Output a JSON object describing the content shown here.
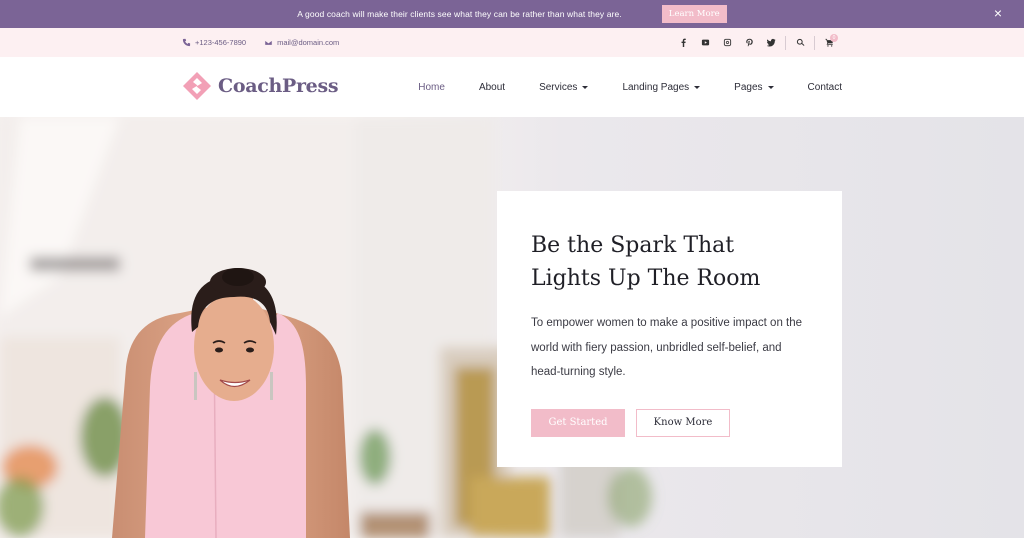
{
  "notice": {
    "text": "A good coach will make their clients see what they can be rather than what they are.",
    "button_label": "Learn More",
    "close_glyph": "×"
  },
  "topbar": {
    "phone": "+123-456-7890",
    "email": "mail@domain.com",
    "social_icons": [
      "facebook-icon",
      "youtube-icon",
      "instagram-icon",
      "pinterest-icon",
      "twitter-icon"
    ],
    "cart_count": "0"
  },
  "header": {
    "logo_text": "CoachPress",
    "nav": [
      {
        "label": "Home",
        "active": true,
        "dropdown": false
      },
      {
        "label": "About",
        "active": false,
        "dropdown": false
      },
      {
        "label": "Services",
        "active": false,
        "dropdown": true
      },
      {
        "label": "Landing Pages",
        "active": false,
        "dropdown": true
      },
      {
        "label": "Pages",
        "active": false,
        "dropdown": true
      },
      {
        "label": "Contact",
        "active": false,
        "dropdown": false
      }
    ]
  },
  "hero": {
    "title": "Be the Spark That Lights Up The Room",
    "text": "To empower women to make a positive impact on the world with fiery passion, unbridled self-belief, and head-turning style.",
    "primary_button": "Get Started",
    "secondary_button": "Know More"
  },
  "colors": {
    "brand_purple": "#7b6496",
    "accent_pink": "#f2bcc9",
    "topbar_bg": "#fdf0f2"
  }
}
